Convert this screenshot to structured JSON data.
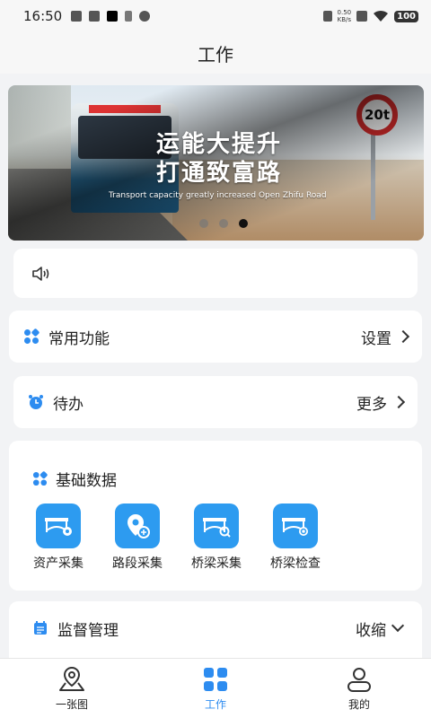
{
  "status": {
    "time": "16:50",
    "netspeed_value": "0.50",
    "netspeed_unit": "KB/s",
    "battery": "100"
  },
  "title": "工作",
  "banner": {
    "headline_line1": "运能大提升",
    "headline_line2": "打通致富路",
    "subline": "Transport capacity greatly increased  Open Zhifu Road",
    "sign_text": "20t",
    "page_count": 3,
    "active_index": 2
  },
  "common": {
    "label": "常用功能",
    "action": "设置"
  },
  "todo": {
    "label": "待办",
    "action": "更多"
  },
  "basic": {
    "label": "基础数据",
    "items": [
      {
        "label": "资产采集",
        "icon": "truck-gear-icon"
      },
      {
        "label": "路段采集",
        "icon": "location-pin-icon"
      },
      {
        "label": "桥梁采集",
        "icon": "bridge-search-icon"
      },
      {
        "label": "桥梁检查",
        "icon": "bridge-check-icon"
      }
    ]
  },
  "supervise": {
    "label": "监督管理",
    "action": "收缩"
  },
  "tabs": [
    {
      "label": "一张图",
      "icon": "map-pin-icon"
    },
    {
      "label": "工作",
      "icon": "grid-icon"
    },
    {
      "label": "我的",
      "icon": "user-icon"
    }
  ],
  "colors": {
    "accent": "#2d8cf0",
    "tile": "#2d9bf0"
  }
}
